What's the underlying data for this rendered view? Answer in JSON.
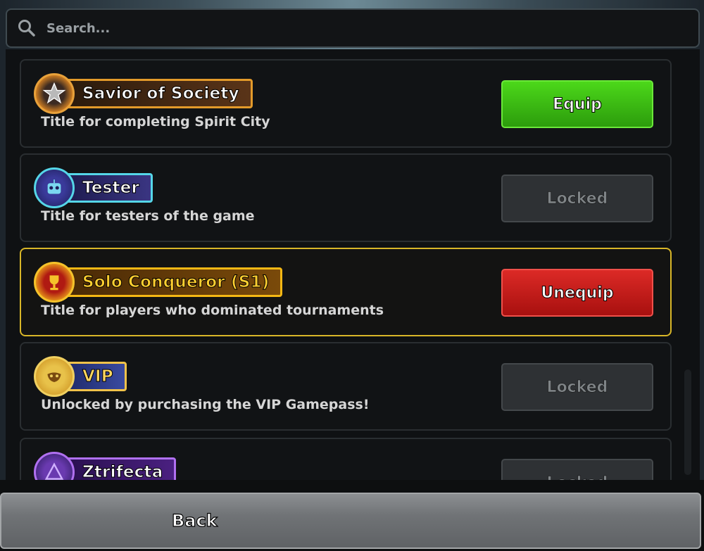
{
  "search": {
    "placeholder": "Search..."
  },
  "titles": [
    {
      "name": "Savior of Society",
      "description": "Title for completing Spirit City",
      "action": "Equip",
      "state": "equip",
      "icon": "star-emblem-icon",
      "plate_color": "#4a2a12",
      "plate_border": "#e39a2a"
    },
    {
      "name": "Tester",
      "description": "Title for testers of the game",
      "action": "Locked",
      "state": "locked",
      "icon": "robot-emblem-icon",
      "plate_color": "#2c2a6a",
      "plate_border": "#55d6e8"
    },
    {
      "name": "Solo Conqueror (S1)",
      "description": "Title for players who dominated tournaments",
      "action": "Unequip",
      "state": "unequip",
      "icon": "trophy-emblem-icon",
      "plate_color": "#6a3c08",
      "plate_border": "#f5b814"
    },
    {
      "name": "VIP",
      "description": "Unlocked by purchasing the VIP Gamepass!",
      "action": "Locked",
      "state": "locked",
      "icon": "mask-emblem-icon",
      "plate_color": "#2a3b8a",
      "plate_border": "#f0c24a"
    },
    {
      "name": "Ztrifecta",
      "description": "",
      "action": "Locked",
      "state": "locked",
      "icon": "triangle-emblem-icon",
      "plate_color": "#3b1a6a",
      "plate_border": "#b070f0"
    }
  ],
  "footer": {
    "back_label": "Back"
  },
  "colors": {
    "equip": "#3ab814",
    "unequip": "#c41a18",
    "locked": "#2e3134",
    "selected_border": "#d8b628"
  }
}
